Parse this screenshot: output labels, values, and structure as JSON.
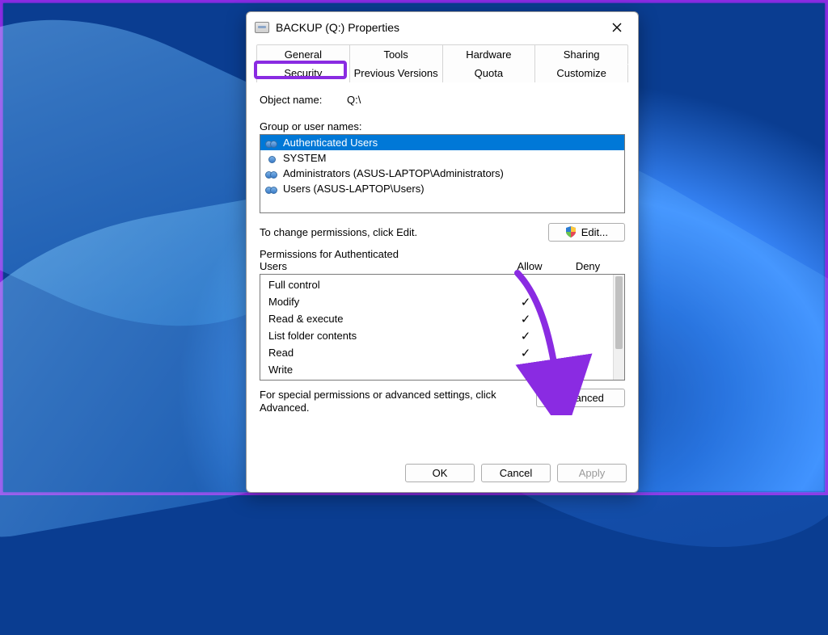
{
  "window": {
    "title": "BACKUP (Q:) Properties"
  },
  "tabs": {
    "row1": [
      "General",
      "Tools",
      "Hardware",
      "Sharing"
    ],
    "row2": [
      "Security",
      "Previous Versions",
      "Quota",
      "Customize"
    ],
    "selected": "Security"
  },
  "object": {
    "label": "Object name:",
    "value": "Q:\\"
  },
  "groups": {
    "label": "Group or user names:",
    "items": [
      {
        "name": "Authenticated Users",
        "icon": "group",
        "selected": true
      },
      {
        "name": "SYSTEM",
        "icon": "user",
        "selected": false
      },
      {
        "name": "Administrators (ASUS-LAPTOP\\Administrators)",
        "icon": "group",
        "selected": false
      },
      {
        "name": "Users (ASUS-LAPTOP\\Users)",
        "icon": "group",
        "selected": false
      }
    ]
  },
  "edit": {
    "hint": "To change permissions, click Edit.",
    "button": "Edit..."
  },
  "permissions": {
    "header_left_line1": "Permissions for Authenticated",
    "header_left_line2": "Users",
    "allow": "Allow",
    "deny": "Deny",
    "rows": [
      {
        "name": "Full control",
        "allow": false
      },
      {
        "name": "Modify",
        "allow": true
      },
      {
        "name": "Read & execute",
        "allow": true
      },
      {
        "name": "List folder contents",
        "allow": true
      },
      {
        "name": "Read",
        "allow": true
      },
      {
        "name": "Write",
        "allow": true
      }
    ]
  },
  "advanced": {
    "text": "For special permissions or advanced settings, click Advanced.",
    "button": "Advanced"
  },
  "footer": {
    "ok": "OK",
    "cancel": "Cancel",
    "apply": "Apply"
  },
  "annotation": {
    "highlight": "security-tab",
    "arrow_color": "#8a2be2"
  }
}
